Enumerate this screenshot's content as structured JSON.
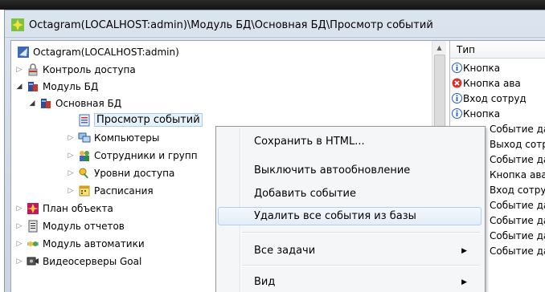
{
  "window": {
    "title": "Octagram(LOCALHOST:admin)\\Модуль БД\\Основная БД\\Просмотр событий"
  },
  "tree": {
    "items": [
      {
        "label": "Octagram(LOCALHOST:admin)",
        "icon": "octagram-app-icon",
        "expander": ""
      },
      {
        "label": "Контроль доступа",
        "icon": "lock-icon",
        "expander": "▷"
      },
      {
        "label": "Модуль БД",
        "icon": "database-module-icon",
        "expander": "◢"
      },
      {
        "label": "Основная БД",
        "icon": "database-icon",
        "expander": "◢"
      },
      {
        "label": "Просмотр событий",
        "icon": "event-log-icon",
        "expander": ""
      },
      {
        "label": "Компьютеры",
        "icon": "computers-icon",
        "expander": "▷"
      },
      {
        "label": "Сотрудники и групп",
        "icon": "employees-icon",
        "expander": "▷"
      },
      {
        "label": "Уровни доступа",
        "icon": "access-levels-icon",
        "expander": "▷"
      },
      {
        "label": "Расписания",
        "icon": "schedule-icon",
        "expander": "▷"
      },
      {
        "label": "План объекта",
        "icon": "floor-plan-icon",
        "expander": "▷"
      },
      {
        "label": "Модуль отчетов",
        "icon": "reports-icon",
        "expander": "▷"
      },
      {
        "label": "Модуль автоматики",
        "icon": "automation-icon",
        "expander": "▷"
      },
      {
        "label": "Видеосерверы Goal",
        "icon": "video-server-icon",
        "expander": "▷"
      }
    ]
  },
  "list": {
    "column_header": "Тип",
    "rows": [
      {
        "text": "Кнопка",
        "icon": "info-icon"
      },
      {
        "text": "Кнопка ава",
        "icon": "error-icon"
      },
      {
        "text": "Вход сотруд",
        "icon": "info-icon"
      },
      {
        "text": "Кнопка",
        "icon": "info-icon"
      },
      {
        "text": "Событие да",
        "icon": ""
      },
      {
        "text": "Выход сотр",
        "icon": ""
      },
      {
        "text": "Событие да",
        "icon": ""
      },
      {
        "text": "Кнопка ава",
        "icon": ""
      },
      {
        "text": "Вход сотруд",
        "icon": ""
      },
      {
        "text": "Событие да",
        "icon": ""
      },
      {
        "text": "Событие да",
        "icon": ""
      },
      {
        "text": "Событие да",
        "icon": ""
      },
      {
        "text": "Событие да",
        "icon": ""
      }
    ]
  },
  "context_menu": {
    "items": [
      {
        "label": "Сохранить в HTML...",
        "submenu": false
      },
      {
        "label": "Выключить автообновление",
        "submenu": false
      },
      {
        "label": "Добавить событие",
        "submenu": false
      },
      {
        "label": "Удалить все события из базы",
        "submenu": false,
        "highlighted": true
      },
      {
        "label": "Все задачи",
        "submenu": true
      },
      {
        "label": "Вид",
        "submenu": true
      }
    ]
  },
  "colors": {
    "selection_bg": "#e5f1fb",
    "menu_highlight": "#e3edf8",
    "error_red": "#d8332a",
    "info_blue": "#1d5fc9"
  }
}
